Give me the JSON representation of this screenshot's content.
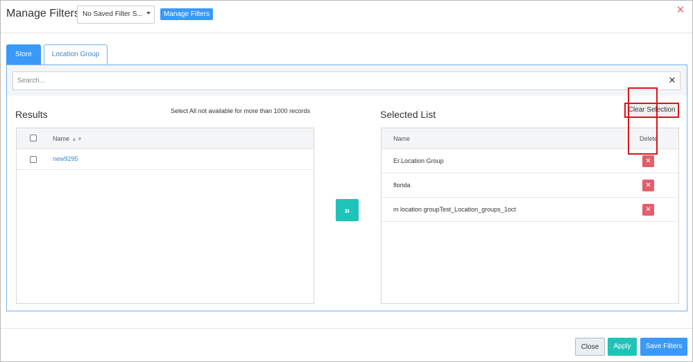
{
  "header": {
    "title": "Manage Filters",
    "saved_filter_value": "No Saved Filter S...",
    "manage_button": "Manage Filters",
    "close_glyph": "✕"
  },
  "tabs": [
    {
      "label": "Store",
      "active": false
    },
    {
      "label": "Location Group",
      "active": true
    }
  ],
  "search": {
    "placeholder": "Search...",
    "value": "",
    "clear_glyph": "✕"
  },
  "results": {
    "title": "Results",
    "note": "Select All not available for more than 1000 records",
    "column_name": "Name",
    "sort_glyph": "▲▼",
    "rows": [
      {
        "name": "new9295",
        "checked": false
      }
    ]
  },
  "move_button_glyph": "»",
  "selected": {
    "title": "Selected List",
    "clear_button": "Clear Selection",
    "column_name": "Name",
    "column_delete": "Delete",
    "delete_glyph": "✕",
    "rows": [
      {
        "name": "Er.Location Group"
      },
      {
        "name": "florida"
      },
      {
        "name": "m location groupTest_Location_groups_1oct"
      }
    ]
  },
  "footer": {
    "close_button": "Close",
    "apply_button": "Apply",
    "save_button": "Save Filters"
  },
  "colors": {
    "primary": "#3a99f7",
    "teal": "#1fc4b8",
    "danger": "#e35d6a",
    "highlight": "#d9141b",
    "link": "#3a87c8"
  }
}
